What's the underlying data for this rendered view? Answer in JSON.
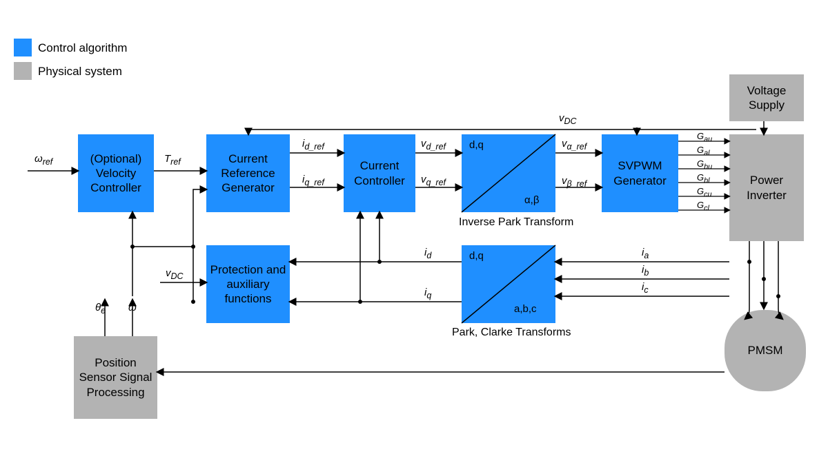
{
  "legend": {
    "control": "Control algorithm",
    "physical": "Physical system"
  },
  "blocks": {
    "velocity": "(Optional) Velocity Controller",
    "refgen": "Current Reference Generator",
    "curctrl": "Current Controller",
    "invpark_tl": "d,q",
    "invpark_br": "α,β",
    "invpark_caption": "Inverse Park Transform",
    "svpwm": "SVPWM Generator",
    "protection": "Protection and auxiliary functions",
    "park_tl": "d,q",
    "park_br": "a,b,c",
    "park_caption": "Park, Clarke Transforms",
    "position": "Position Sensor Signal Processing",
    "voltage": "Voltage Supply",
    "inverter": "Power Inverter",
    "pmsm": "PMSM"
  },
  "signals": {
    "omega_ref": "ω<sub>ref</sub>",
    "T_ref": "T<sub>ref</sub>",
    "id_ref": "i<sub>d_ref</sub>",
    "iq_ref": "i<sub>q_ref</sub>",
    "vd_ref": "v<sub>d_ref</sub>",
    "vq_ref": "v<sub>q_ref</sub>",
    "va_ref": "v<sub>α_ref</sub>",
    "vb_ref": "v<sub>β_ref</sub>",
    "Gau": "G<sub>au</sub>",
    "Gal": "G<sub>al</sub>",
    "Gbu": "G<sub>bu</sub>",
    "Gbl": "G<sub>bl</sub>",
    "Gcu": "G<sub>cu</sub>",
    "Gcl": "G<sub>cl</sub>",
    "id": "i<sub>d</sub>",
    "iq": "i<sub>q</sub>",
    "ia": "i<sub>a</sub>",
    "ib": "i<sub>b</sub>",
    "ic": "i<sub>c</sub>",
    "vDC": "v<sub>DC</sub>",
    "theta_e": "θ<sub>e</sub>",
    "omega": "ω"
  }
}
